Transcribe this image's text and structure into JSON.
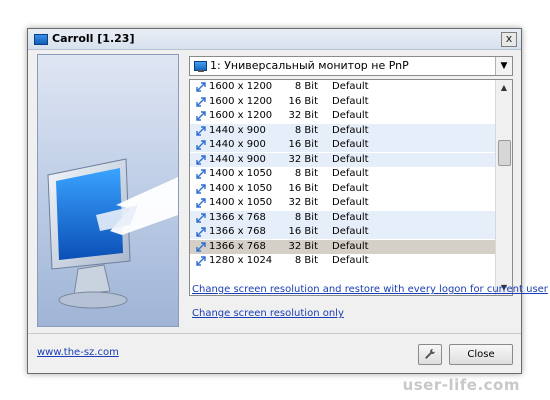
{
  "window": {
    "title": "Carroll [1.23]",
    "close_glyph": "x"
  },
  "monitor": {
    "selected": "1: Универсальный монитор не PnP",
    "icon": "monitor-icon"
  },
  "modes": [
    {
      "res": "1600 x 1200",
      "bits": "8 Bit",
      "freq": "Default"
    },
    {
      "res": "1600 x 1200",
      "bits": "16 Bit",
      "freq": "Default"
    },
    {
      "res": "1600 x 1200",
      "bits": "32 Bit",
      "freq": "Default"
    },
    {
      "res": "1440 x 900",
      "bits": "8 Bit",
      "freq": "Default"
    },
    {
      "res": "1440 x 900",
      "bits": "16 Bit",
      "freq": "Default"
    },
    {
      "res": "1440 x 900",
      "bits": "32 Bit",
      "freq": "Default"
    },
    {
      "res": "1400 x 1050",
      "bits": "8 Bit",
      "freq": "Default"
    },
    {
      "res": "1400 x 1050",
      "bits": "16 Bit",
      "freq": "Default"
    },
    {
      "res": "1400 x 1050",
      "bits": "32 Bit",
      "freq": "Default"
    },
    {
      "res": "1366 x 768",
      "bits": "8 Bit",
      "freq": "Default"
    },
    {
      "res": "1366 x 768",
      "bits": "16 Bit",
      "freq": "Default"
    },
    {
      "res": "1366 x 768",
      "bits": "32 Bit",
      "freq": "Default"
    },
    {
      "res": "1280 x 1024",
      "bits": "8 Bit",
      "freq": "Default"
    }
  ],
  "links": {
    "restore": "Change screen resolution and restore with every logon for current user",
    "only": "Change screen resolution only",
    "site": "www.the-sz.com"
  },
  "buttons": {
    "close": "Close",
    "settings_icon": "wrench-icon"
  },
  "watermark": "user-life.com",
  "colors": {
    "link": "#1a3eb5",
    "alt_row": "#e6eef9",
    "selected_row": "#d4d0c8"
  }
}
